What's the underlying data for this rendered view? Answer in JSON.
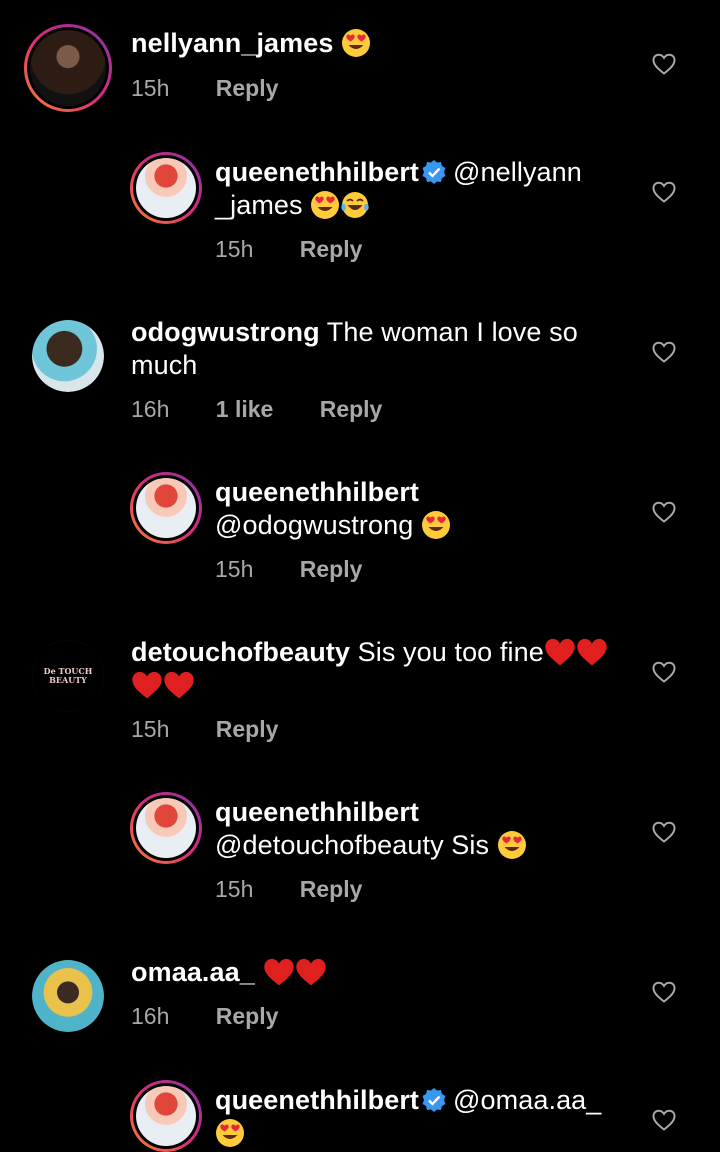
{
  "comments": [
    {
      "user": "nellyann_james",
      "text": "",
      "emojis": [
        "heart-eyes"
      ],
      "time": "15h",
      "likes": "",
      "reply": "Reply"
    },
    {
      "user": "queenethhilbert",
      "verified": true,
      "text": "@nellyann _james",
      "emojis": [
        "heart-eyes",
        "tears-of-joy"
      ],
      "time": "15h",
      "reply": "Reply"
    },
    {
      "user": "odogwustrong",
      "text": "The woman I love so much",
      "time": "16h",
      "likes": "1 like",
      "reply": "Reply"
    },
    {
      "user": "queenethhilbert",
      "text": "@odogwustrong",
      "emojis": [
        "heart-eyes"
      ],
      "time": "15h",
      "reply": "Reply"
    },
    {
      "user": "detouchofbeauty",
      "text": "Sis you too fine",
      "emojis": [
        "red-heart",
        "red-heart",
        "red-heart",
        "red-heart"
      ],
      "avatar_text": "De TOUCH BEAUTY",
      "time": "15h",
      "reply": "Reply"
    },
    {
      "user": "queenethhilbert",
      "text": "@detouchofbeauty Sis",
      "emojis": [
        "heart-eyes"
      ],
      "time": "15h",
      "reply": "Reply"
    },
    {
      "user": "omaa.aa_",
      "text": "",
      "emojis": [
        "red-heart",
        "red-heart"
      ],
      "time": "16h",
      "reply": "Reply"
    },
    {
      "user": "queenethhilbert",
      "verified": true,
      "text": "@omaa.aa_",
      "emojis": [
        "heart-eyes"
      ]
    }
  ],
  "colors": {
    "background": "#000000",
    "text": "#ffffff",
    "meta": "#a8a8a8",
    "verified": "#3897f0",
    "heart_red": "#e0201f"
  }
}
